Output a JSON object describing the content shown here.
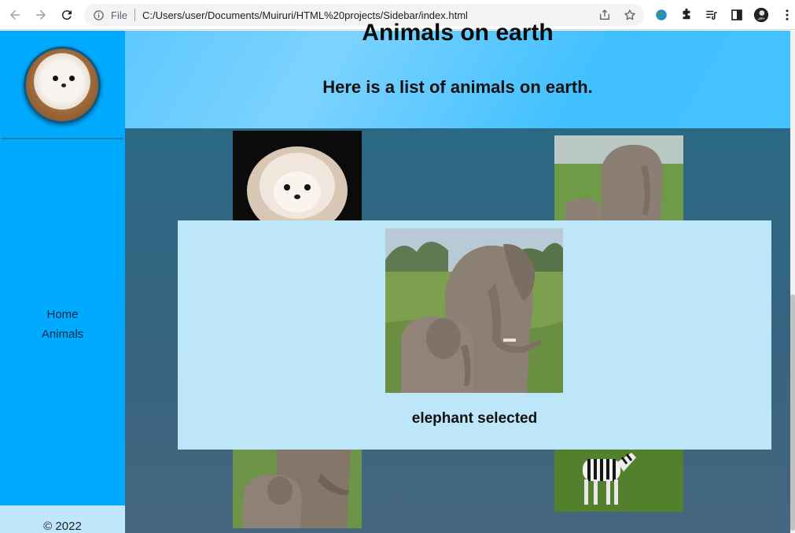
{
  "browser": {
    "file_label": "File",
    "url": "C:/Users/user/Documents/Muiruri/HTML%20projects/Sidebar/index.html",
    "icons": [
      "back-arrow-icon",
      "forward-arrow-icon",
      "reload-icon",
      "info-icon",
      "share-icon",
      "bookmark-star-icon",
      "extension-globe-icon",
      "puzzle-icon",
      "reading-list-icon",
      "side-panel-icon",
      "profile-avatar",
      "kebab-menu-icon"
    ]
  },
  "sidebar": {
    "nav_items": [
      "Home",
      "Animals"
    ],
    "footer": "© 2022",
    "background": "#00aaff"
  },
  "header": {
    "title": "Animals on earth",
    "subtitle": "Here is a list of animals on earth."
  },
  "gallery": {
    "items": [
      "pomeranian",
      "elephant",
      "elephant",
      "zebra"
    ]
  },
  "modal": {
    "caption": "elephant selected"
  }
}
